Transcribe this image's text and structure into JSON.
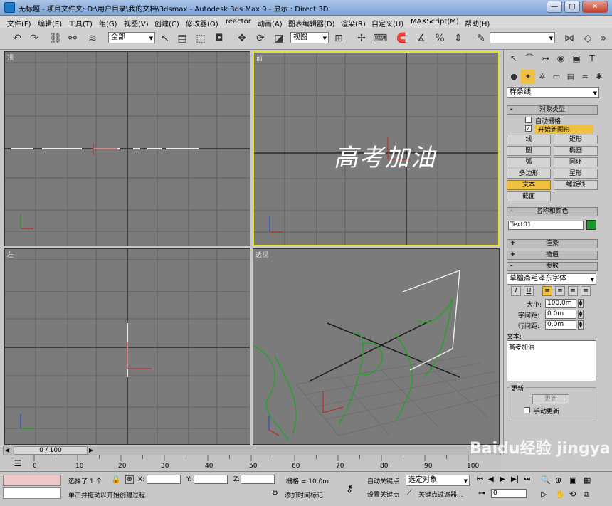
{
  "window": {
    "title": "无标题    - 项目文件夹: D:\\用户目录\\我的文档\\3dsmax    - Autodesk 3ds Max 9    - 显示 : Direct 3D",
    "buttons": [
      "—",
      "▢",
      "✕"
    ]
  },
  "menu": [
    "文件(F)",
    "编辑(E)",
    "工具(T)",
    "组(G)",
    "视图(V)",
    "创建(C)",
    "修改器(O)",
    "reactor",
    "动画(A)",
    "图表编辑器(D)",
    "渲染(R)",
    "自定义(U)",
    "MAXScript(M)",
    "帮助(H)"
  ],
  "toolbar": {
    "selection_filter": "全部",
    "ref_coord": "视图",
    "named_selection": ""
  },
  "viewports": {
    "top": {
      "label": "顶"
    },
    "front": {
      "label": "前",
      "text_content": "高考加油"
    },
    "left": {
      "label": "左"
    },
    "perspective": {
      "label": "透视"
    }
  },
  "command_panel": {
    "category_dropdown": "样条线",
    "object_type": {
      "title": "对象类型",
      "auto_grid": "自动栅格",
      "start_new_shape": "开始新图形",
      "buttons": [
        "线",
        "矩形",
        "圆",
        "椭圆",
        "弧",
        "圆环",
        "多边形",
        "星形",
        "文本",
        "螺旋线",
        "截面"
      ],
      "selected": "文本"
    },
    "name_color": {
      "title": "名称和颜色",
      "name": "Text01",
      "color": "#1a9a2a"
    },
    "render_rollout": "渲染",
    "interp_rollout": "插值",
    "params_rollout": "参数",
    "params": {
      "font": "草檀斋毛泽东字体",
      "size_label": "大小:",
      "size": "100.0m",
      "kerning_label": "字间距:",
      "kerning": "0.0m",
      "leading_label": "行间距:",
      "leading": "0.0m",
      "text_label": "文本:",
      "text": "高考加油",
      "update_group": "更新",
      "update_button": "更新",
      "manual_update": "手动更新"
    },
    "style_buttons": [
      "I",
      "U"
    ]
  },
  "timeline": {
    "frame": "0 / 100",
    "ticks": [
      "0",
      "10",
      "20",
      "30",
      "40",
      "50",
      "60",
      "70",
      "80",
      "90",
      "100"
    ]
  },
  "status": {
    "selected": "选择了 1 个",
    "prompt": "单击并拖动以开始创建过程",
    "x_label": "X:",
    "y_label": "Y:",
    "z_label": "Z:",
    "grid": "栅格 = 10.0m",
    "add_time_tag": "添加时间标记",
    "auto_key": "自动关键点",
    "set_key": "设置关键点",
    "selected_object": "选定对象",
    "key_filters": "关键点过滤器...",
    "frame_field": "0"
  },
  "watermark": "Baidu经验 jingyan.baidu.com"
}
